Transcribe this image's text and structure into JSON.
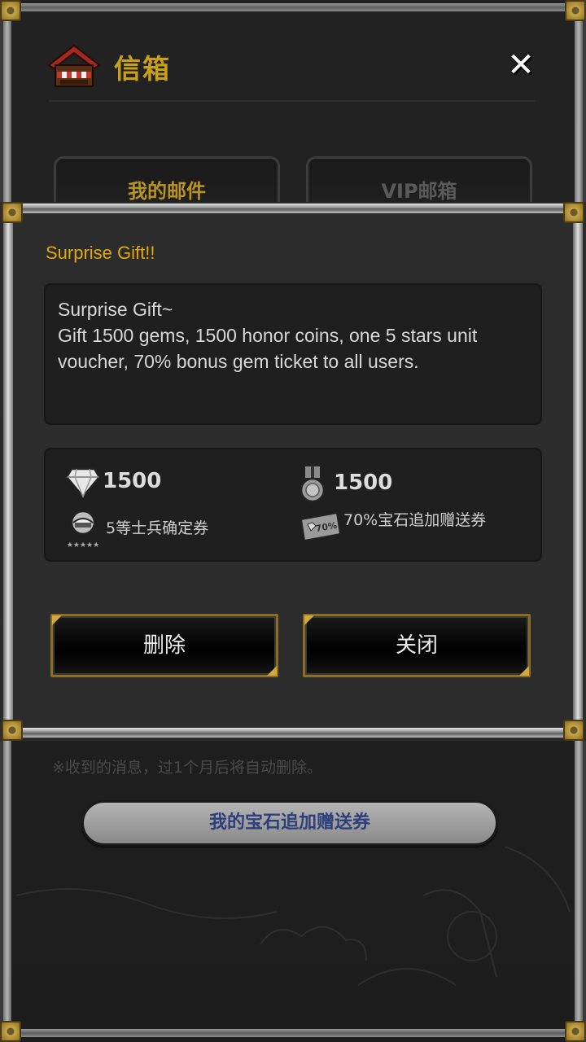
{
  "header": {
    "title": "信箱"
  },
  "tabs": [
    {
      "label": "我的邮件",
      "active": true
    },
    {
      "label": "VIP邮箱",
      "active": false
    }
  ],
  "popup": {
    "title": "Surprise Gift!!",
    "message_lines": [
      "Surprise Gift~",
      "Gift 1500 gems, 1500 honor coins, one 5 stars unit",
      "voucher, 70% bonus gem ticket to all users."
    ],
    "rewards": {
      "gems_amount": "1500",
      "honor_amount": "1500",
      "unit_voucher_label": "5等士兵确定券",
      "gem_ticket_label": "70%宝石追加赠送券",
      "gem_ticket_badge": "70%"
    },
    "buttons": {
      "delete": "删除",
      "close": "关闭"
    }
  },
  "footer": {
    "notice": "※收到的消息，过1个月后将自动删除。",
    "gem_coupon_button": "我的宝石追加赠送券"
  },
  "colors": {
    "gold": "#c9a01c",
    "title_orange": "#e2a90f",
    "coupon_text": "#2d3f7a"
  }
}
